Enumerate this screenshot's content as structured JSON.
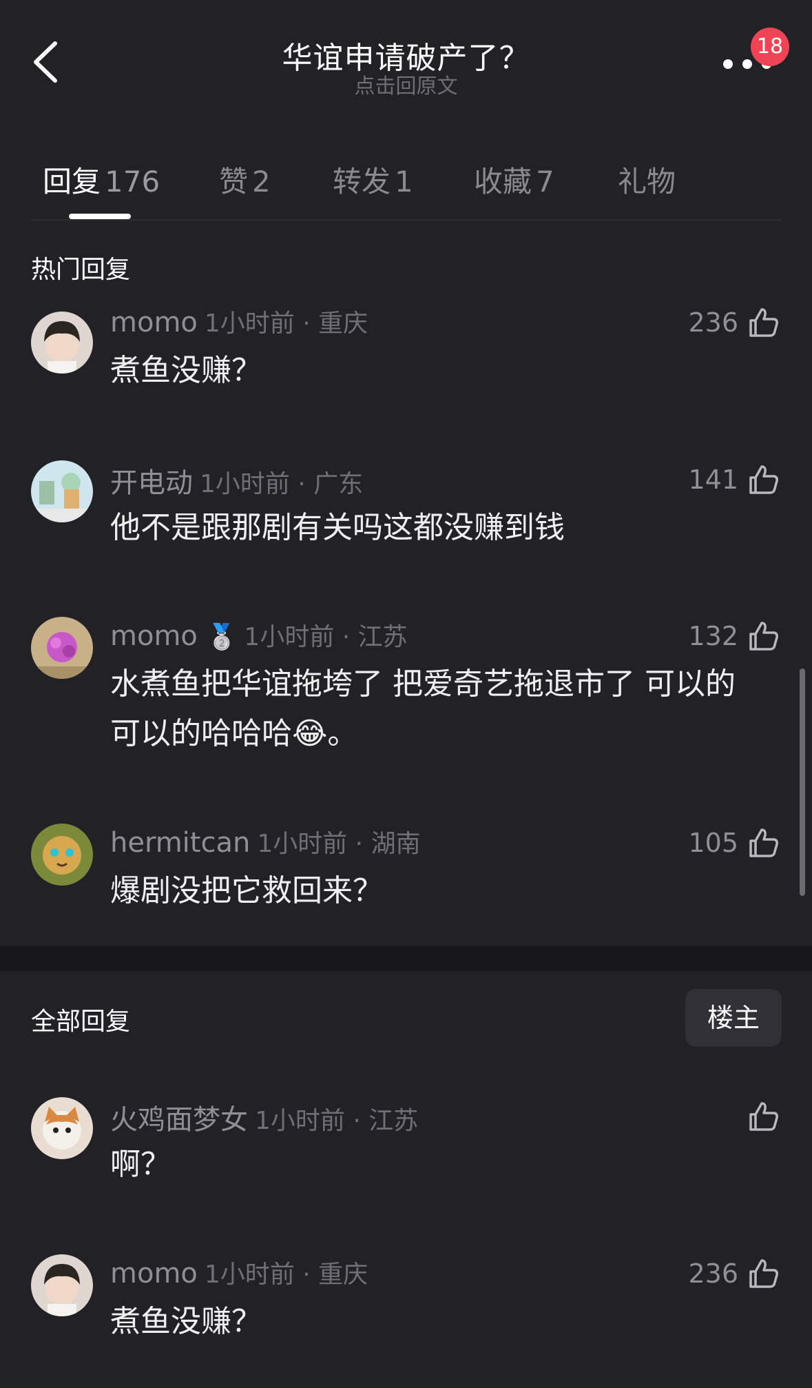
{
  "header": {
    "title": "华谊申请破产了？",
    "subtitle": "点击回原文",
    "notification_count": "18"
  },
  "tabs": [
    {
      "label": "回复",
      "count": "176"
    },
    {
      "label": "赞",
      "count": "2"
    },
    {
      "label": "转发",
      "count": "1"
    },
    {
      "label": "收藏",
      "count": "7"
    },
    {
      "label": "礼物",
      "count": ""
    }
  ],
  "hot": {
    "title": "热门回复",
    "comments": [
      {
        "user": "momo",
        "time": "1小时前",
        "location": "重庆",
        "likes": "236",
        "text": "煮鱼没赚？"
      },
      {
        "user": "开电动",
        "time": "1小时前",
        "location": "广东",
        "likes": "141",
        "text": "他不是跟那剧有关吗这都没赚到钱"
      },
      {
        "user": "momo",
        "badge": "🥈",
        "time": "1小时前",
        "location": "江苏",
        "likes": "132",
        "text": "水煮鱼把华谊拖垮了 把爱奇艺拖退市了 可以的可以的哈哈哈😂。"
      },
      {
        "user": "hermitcan",
        "time": "1小时前",
        "location": "湖南",
        "likes": "105",
        "text": "爆剧没把它救回来？"
      }
    ]
  },
  "all": {
    "title": "全部回复",
    "op_button": "楼主",
    "comments": [
      {
        "user": "火鸡面梦女",
        "time": "1小时前",
        "location": "江苏",
        "likes": "",
        "text": "啊？"
      },
      {
        "user": "momo",
        "time": "1小时前",
        "location": "重庆",
        "likes": "236",
        "text": "煮鱼没赚？"
      }
    ]
  },
  "colors": {
    "background": "#212126",
    "badge": "#ee4455"
  }
}
